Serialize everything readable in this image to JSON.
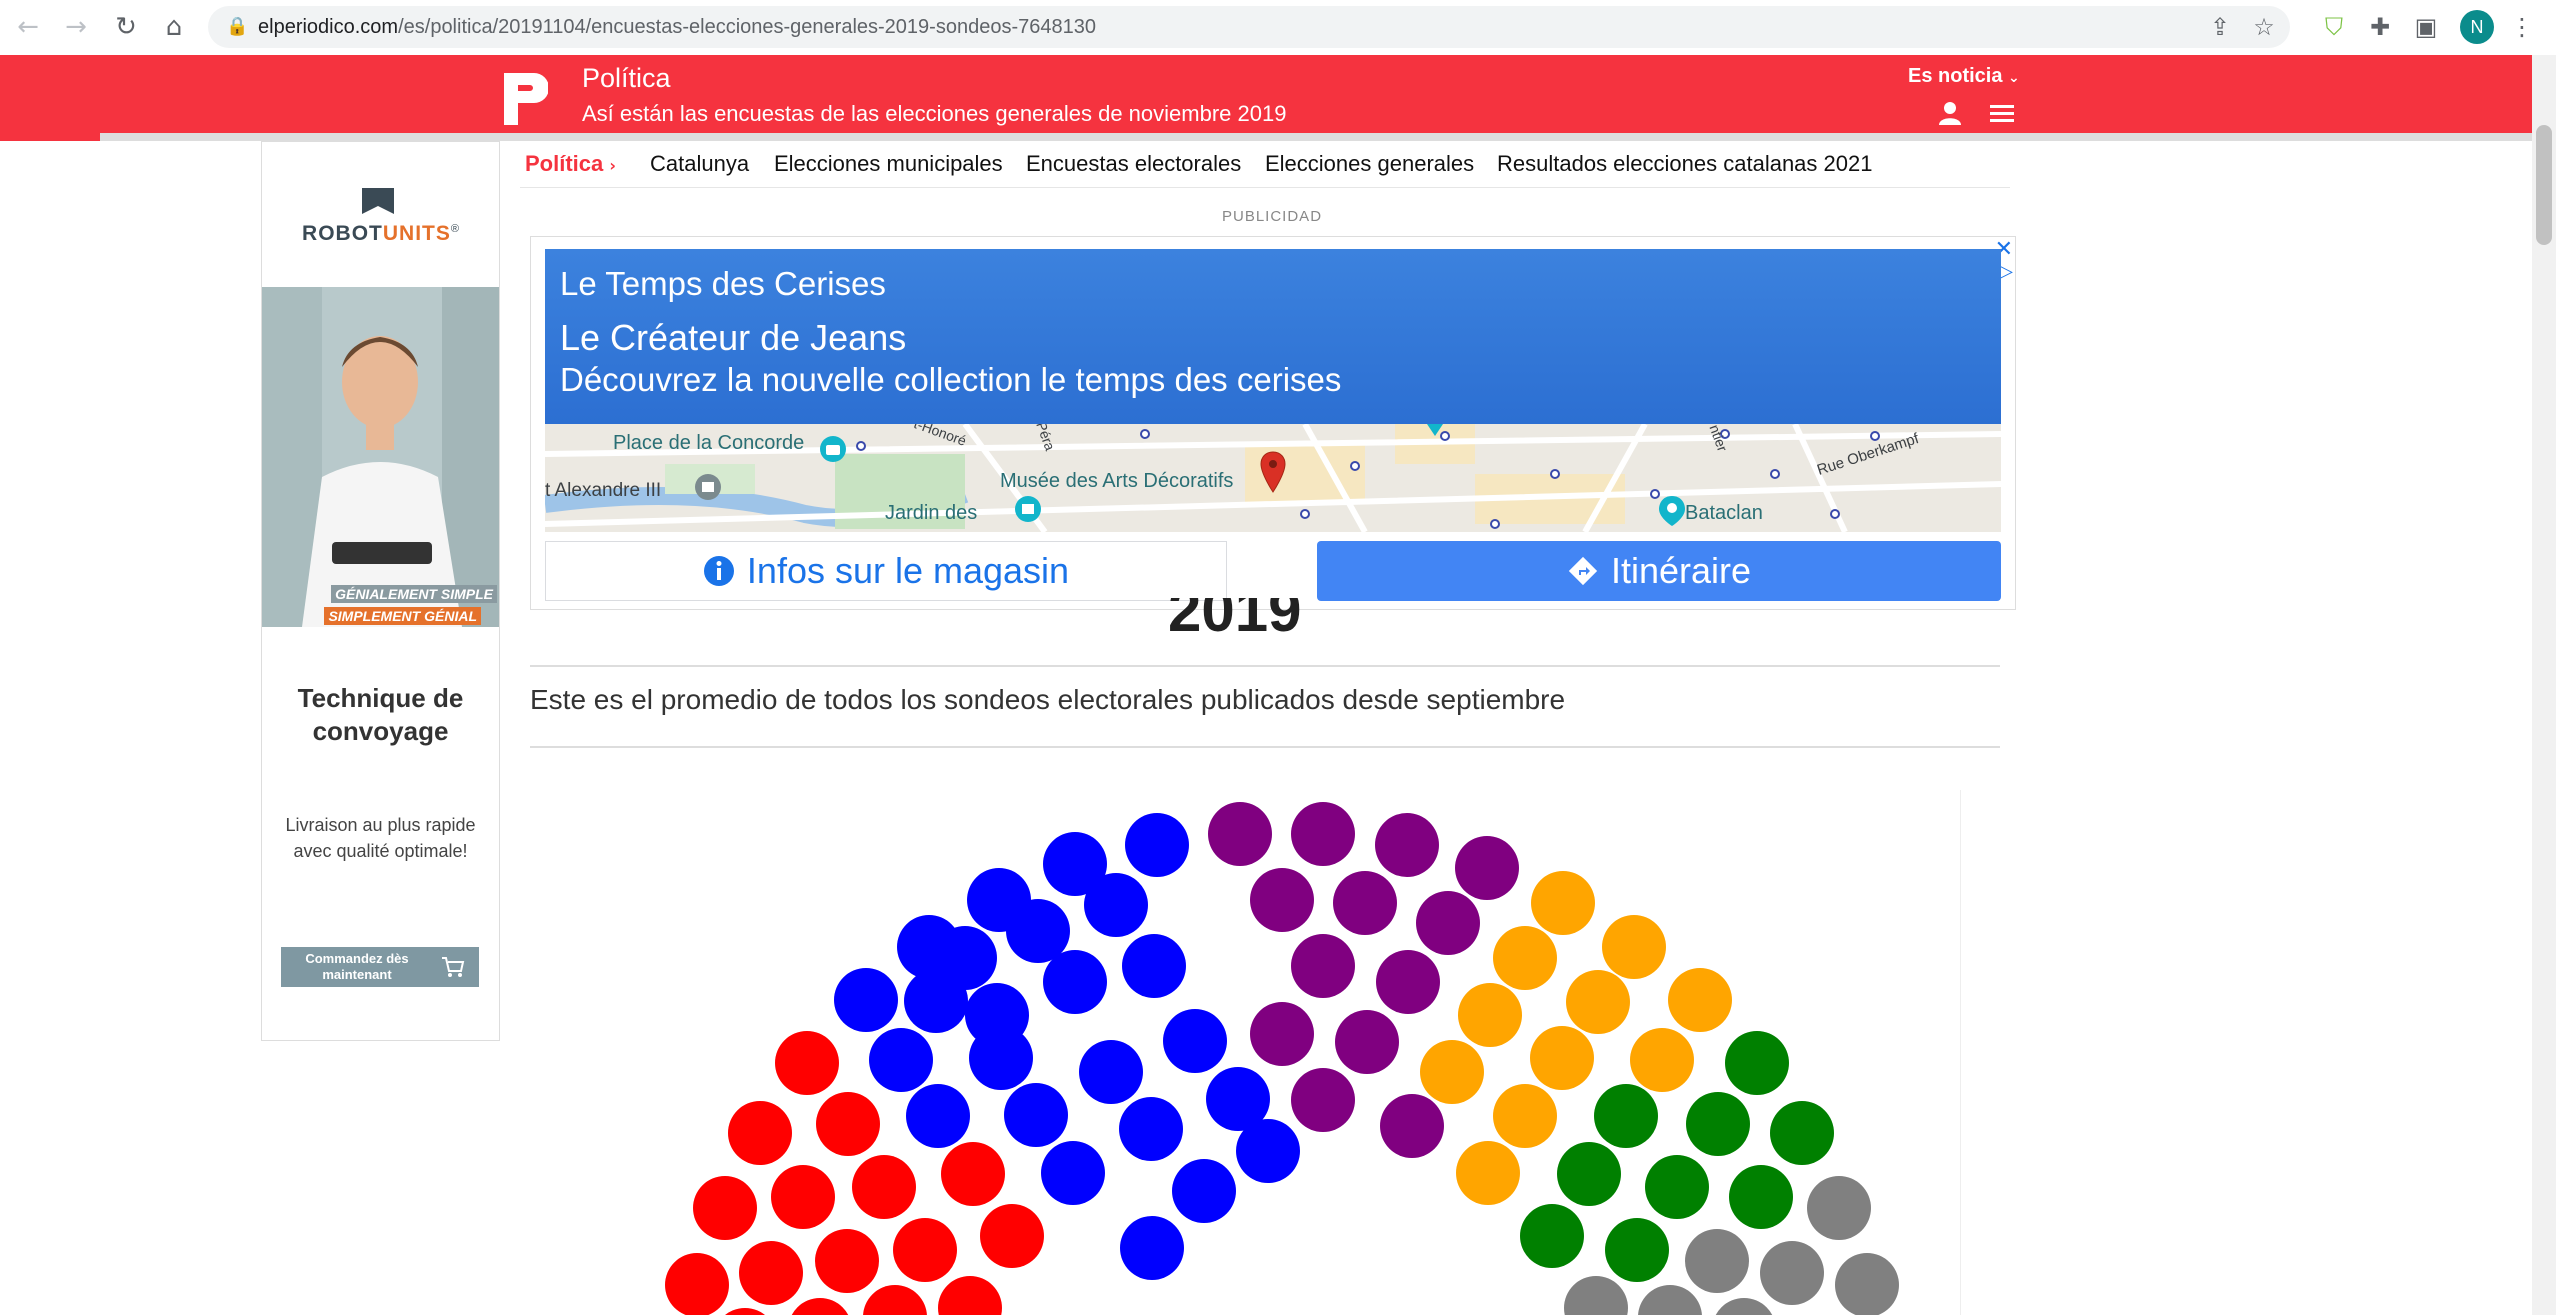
{
  "browser": {
    "url_domain": "elperiodico.com",
    "url_path": "/es/politica/20191104/encuestas-elecciones-generales-2019-sondeos-7648130",
    "profile_initial": "N"
  },
  "header": {
    "section": "Política",
    "article_title": "Así están las encuestas de las elecciones generales de noviembre 2019",
    "es_noticia": "Es noticia",
    "brand_color": "#f5333f"
  },
  "subnav": {
    "active": "Política",
    "items": [
      "Catalunya",
      "Elecciones municipales",
      "Encuestas electorales",
      "Elecciones generales",
      "Resultados elecciones catalanas 2021"
    ]
  },
  "left_ad": {
    "logo_part1": "ROBOT",
    "logo_part2": "UNITS",
    "logo_mark": "®",
    "tag1": "GÉNIALEMENT SIMPLE",
    "tag2": "SIMPLEMENT GÉNIAL",
    "heading": "Technique de convoyage",
    "body": "Livraison au plus rapide avec qualité optimale!",
    "cta": "Commandez dès maintenant"
  },
  "top_ad": {
    "label": "PUBLICIDAD",
    "line1": "Le Temps des Cerises",
    "line2": "Le Créateur de Jeans",
    "line3": "Découvrez la nouvelle collection le temps des cerises",
    "map_labels": [
      "Place de la Concorde",
      "Musée des Arts Décoratifs",
      "Jardin des",
      "t Alexandre III",
      "Bataclan",
      "Rue Oberkampf",
      "t-Honoré",
      "Péra",
      "ntier"
    ],
    "btn_info": "Infos sur le magasin",
    "btn_route": "Itinéraire"
  },
  "article": {
    "title_fragment": "2019",
    "subtitle": "Este es el promedio de todos los sondeos electorales publicados desde septiembre"
  },
  "colors": {
    "party_red": "#ff0000",
    "party_blue": "#0000ff",
    "party_purple": "#800080",
    "party_orange": "#ffa500",
    "party_green": "#008000",
    "party_gray": "#808080"
  }
}
